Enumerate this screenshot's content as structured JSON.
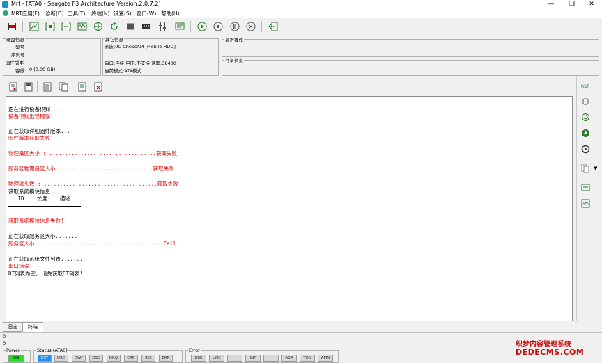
{
  "window": {
    "title": "Mrt - [ATA0 - Seagate F3 Architecture Version:2.0.7.2]",
    "minimize": "—",
    "restore": "❐",
    "close": "✕"
  },
  "menu": {
    "items": [
      {
        "label": "MRT应用(F)"
      },
      {
        "label": "诊断(D)"
      },
      {
        "label": "工具(T)"
      },
      {
        "label": "终端(N)"
      },
      {
        "label": "设置(S)"
      },
      {
        "label": "窗口(W)"
      },
      {
        "label": "帮助(H)"
      }
    ]
  },
  "disk_info": {
    "group_label": "硬盘信息",
    "model_label": "型号",
    "serial_label": "序列号",
    "firmware_label": "固件版本",
    "capacity_label": "容量:",
    "capacity_value": "0 (0.00 GB)"
  },
  "other_info": {
    "group_label": "其它信息",
    "family": "家族:0C-ChepsAM [Mobile HDD]",
    "port": "串口:连接  电压:不支持  速率:38400",
    "mode": "当前模式:ATA模式"
  },
  "recent_ops": {
    "group_label": "最近操作"
  },
  "task_info": {
    "group_label": "任务信息"
  },
  "log": {
    "lines": [
      {
        "text": "正在进行设备识别...",
        "color": "black"
      },
      {
        "text": "设备识别出现错误!",
        "color": "red"
      },
      {
        "text": "",
        "color": "black"
      },
      {
        "text": "正在获取详细固件版本...",
        "color": "black"
      },
      {
        "text": "固件版本获取失败!",
        "color": "red"
      },
      {
        "text": "",
        "color": "black"
      },
      {
        "text": "物理扇区大小 : ..................................获取失败",
        "color": "red"
      },
      {
        "text": "",
        "color": "black"
      },
      {
        "text": "服务区物理扇区大小 : ............................获取失败",
        "color": "red"
      },
      {
        "text": "",
        "color": "black"
      },
      {
        "text": "物理磁头数 : ....................................获取失败",
        "color": "red"
      },
      {
        "text": "获取系统模块信息...",
        "color": "black"
      },
      {
        "text": "   ID    长度    描述",
        "color": "black"
      },
      {
        "text": "",
        "color": "black"
      },
      {
        "text": "",
        "color": "black"
      },
      {
        "text": "",
        "color": "black"
      },
      {
        "text": "获取系统模块信息失败!",
        "color": "red"
      },
      {
        "text": "",
        "color": "black"
      },
      {
        "text": "正在获取服务区大小.......",
        "color": "black"
      },
      {
        "text": "服务区大小 : ......................................Fail",
        "color": "red"
      },
      {
        "text": "",
        "color": "black"
      },
      {
        "text": "正在获取系统文件列表.......",
        "color": "black"
      },
      {
        "text": "串口错误!",
        "color": "red"
      },
      {
        "text": "DT列表为空, 请先获取DT列表!",
        "color": "black"
      }
    ]
  },
  "tabs": [
    {
      "label": "日志"
    },
    {
      "label": "终端"
    }
  ],
  "bottom_rows": [
    "0",
    "0"
  ],
  "status": {
    "power_label": "Power",
    "power_value": "ON",
    "status_label": "Status (ATA0)",
    "status_flags": [
      "BSY",
      "DRD",
      "DWF",
      "DSC",
      "DRQ",
      "CRR",
      "IDX",
      "ERR"
    ],
    "error_label": "Error",
    "error_flags": [
      "BBK",
      "UNC",
      "",
      "INF",
      "",
      "ABR",
      "TON",
      "AMN"
    ]
  },
  "watermark": {
    "line1": "织梦内容管理系统",
    "line2": "DEDECMS.COM"
  },
  "colors": {
    "error_red": "#e00000",
    "flag_on": "#1e90ff",
    "power_on": "#20e020"
  }
}
